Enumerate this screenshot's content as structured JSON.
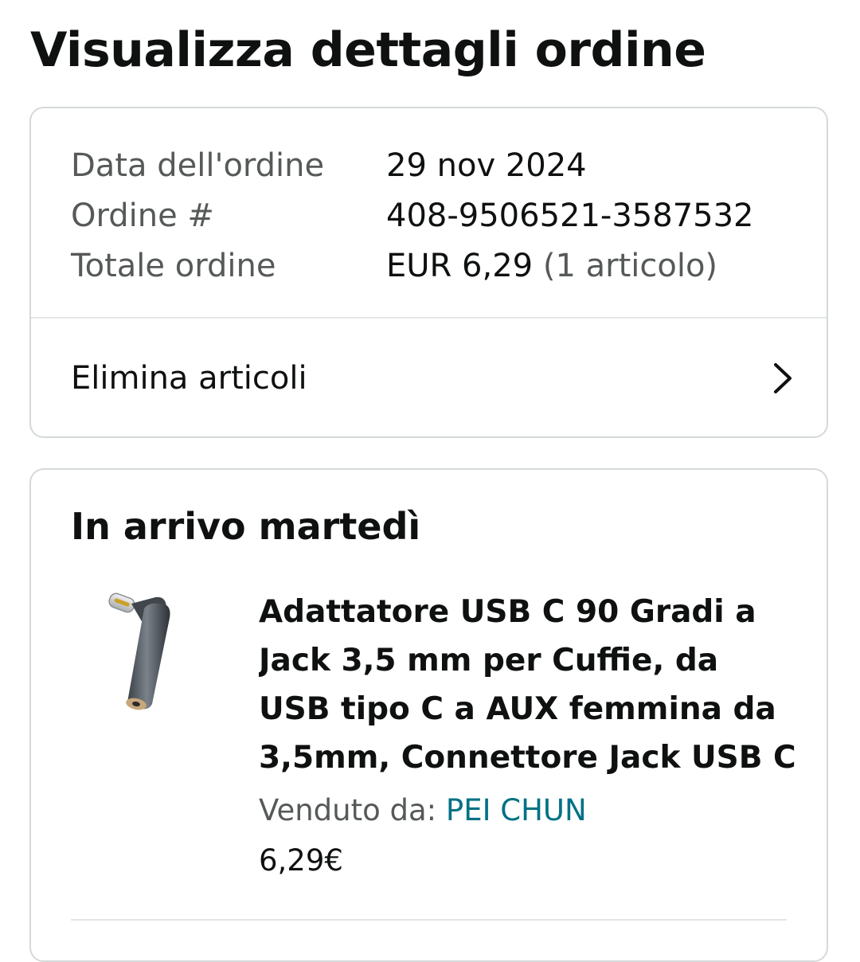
{
  "page": {
    "title": "Visualizza dettagli ordine"
  },
  "summary": {
    "rows": [
      {
        "label": "Data dell'ordine",
        "value": "29 nov 2024"
      },
      {
        "label": "Ordine #",
        "value": "408-9506521-3587532"
      },
      {
        "label": "Totale ordine",
        "value": "EUR 6,29",
        "extra": "(1 articolo)"
      }
    ],
    "action": {
      "label": "Elimina articoli",
      "icon": "chevron-right-icon"
    }
  },
  "shipment": {
    "heading": "In arrivo martedì",
    "product": {
      "image_icon": "usb-c-audio-adapter-image",
      "title": "Adattatore USB C 90 Gradi a Jack 3,5 mm per Cuffie, da USB tipo C a AUX femmina da 3,5mm, Connettore Jack USB C",
      "seller_label": "Venduto da:",
      "seller_name": "PEI CHUN",
      "price": "6,29€"
    }
  },
  "colors": {
    "text_primary": "#0f1111",
    "text_secondary": "#565959",
    "link": "#007185",
    "border": "#d5d9d9"
  }
}
